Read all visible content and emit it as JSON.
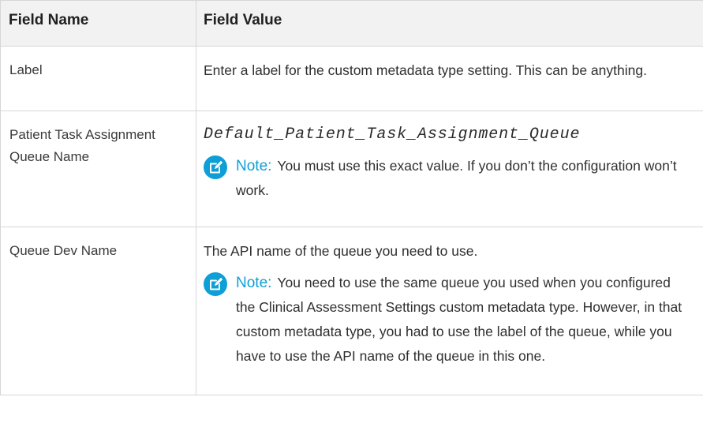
{
  "table": {
    "headers": [
      "Field Name",
      "Field Value"
    ],
    "rows": [
      {
        "name": "Label",
        "value": "Enter a label for the custom metadata type setting. This can be anything."
      },
      {
        "name": "Patient Task Assignment Queue Name",
        "code": "Default_Patient_Task_Assignment_Queue",
        "note_label": "Note:",
        "note_text": "You must use this exact value. If you don’t the configuration won’t work."
      },
      {
        "name": "Queue Dev Name",
        "value": "The API name of the queue you need to use.",
        "note_label": "Note:",
        "note_text": "You need to use the same queue you used when you configured the Clinical Assessment Settings custom metadata type. However, in that custom metadata type, you had to use the label of the queue, while you have to use the API name of the queue in this one."
      }
    ]
  },
  "icons": {
    "note": "edit-note-icon"
  },
  "colors": {
    "note_accent": "#0d9fd6",
    "header_bg": "#f2f2f2",
    "border": "#d6d6d6"
  }
}
